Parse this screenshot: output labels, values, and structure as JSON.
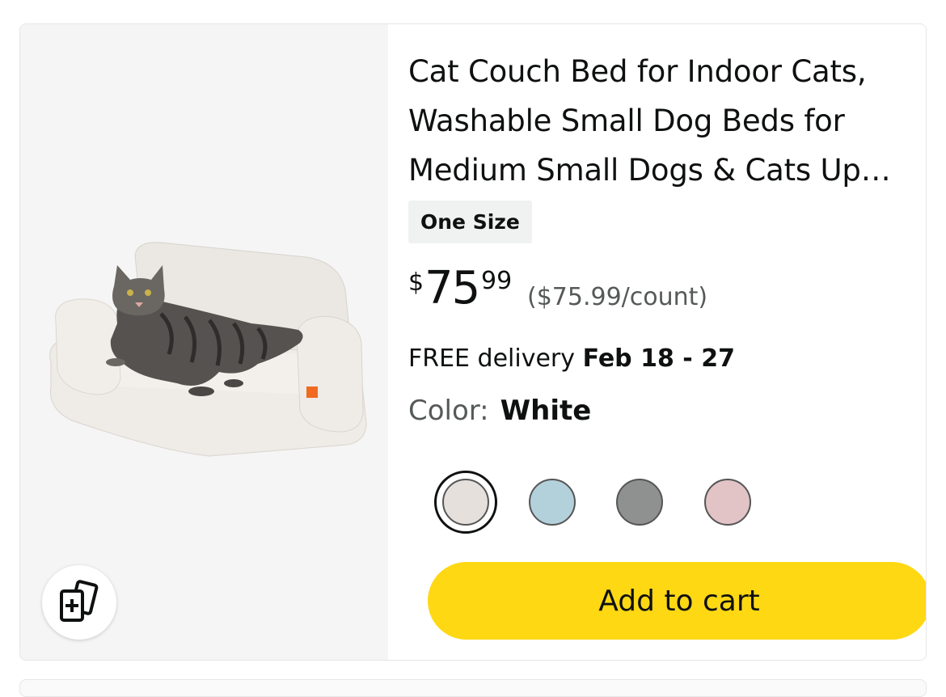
{
  "product": {
    "title": "Cat Couch Bed for Indoor Cats, Washable Small Dog Beds for Medium Small Dogs & Cats Up to...",
    "size_badge": "One Size",
    "price": {
      "symbol": "$",
      "whole": "75",
      "fraction": "99",
      "unit_price": "($75.99/count)"
    },
    "delivery": {
      "prefix": "FREE delivery",
      "dates": "Feb 18 - 27"
    },
    "color": {
      "label": "Color:",
      "selected": "White",
      "swatches": [
        {
          "name": "White",
          "hex": "#e6e0dc",
          "selected": true
        },
        {
          "name": "Blue",
          "hex": "#b3d1db",
          "selected": false
        },
        {
          "name": "Gray",
          "hex": "#8f9090",
          "selected": false
        },
        {
          "name": "Pink",
          "hex": "#e2c3c6",
          "selected": false
        }
      ]
    },
    "add_to_cart_label": "Add to cart",
    "compare_icon": "compare-cards-icon"
  },
  "colors": {
    "button_yellow": "#ffd814",
    "text_primary": "#0f1111",
    "text_secondary": "#565959",
    "image_background": "#f5f5f5"
  }
}
